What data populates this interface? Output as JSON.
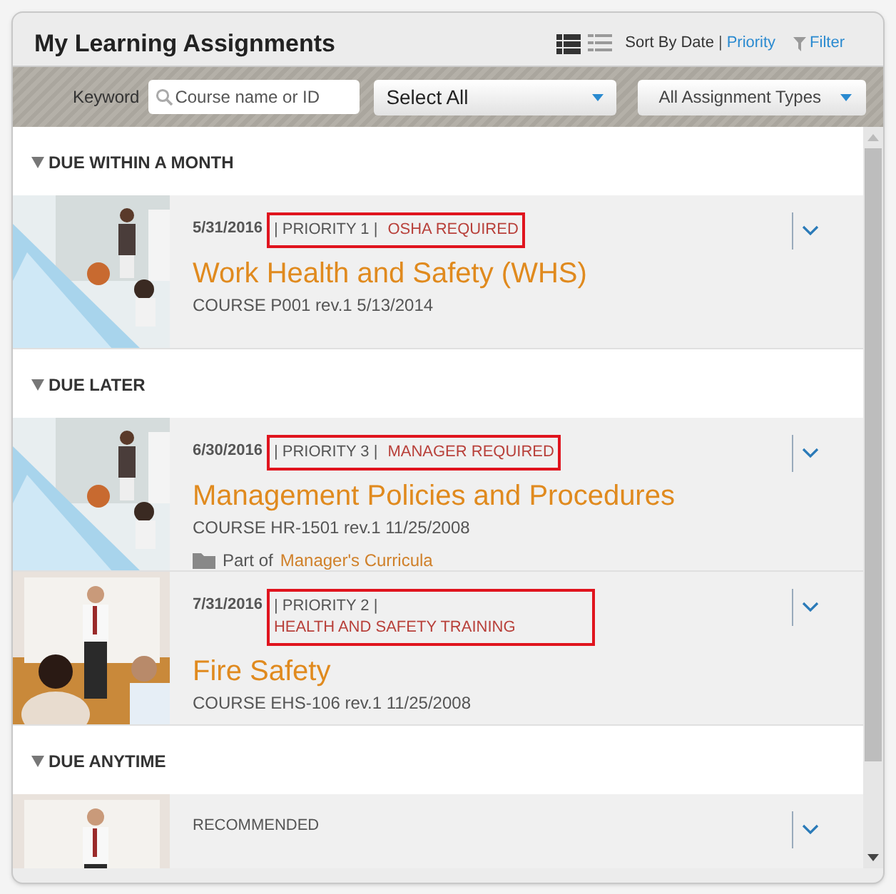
{
  "header": {
    "title": "My Learning Assignments",
    "view_modes": [
      {
        "kind": "detail",
        "selected": true
      },
      {
        "kind": "list",
        "selected": false
      }
    ],
    "sort_label": "Sort By",
    "sort_separator": "|",
    "sort_options": [
      {
        "label": "Date",
        "selected": true
      },
      {
        "label": "Priority",
        "selected": false
      }
    ],
    "filter_label": "Filter"
  },
  "filter_bar": {
    "keyword_label": "Keyword",
    "keyword_placeholder": "Course name or ID",
    "select": "Select All",
    "types": "All Assignment Types"
  },
  "sections": [
    {
      "title": "DUE WITHIN A MONTH",
      "expanded": true,
      "items": [
        {
          "date": "5/31/2016",
          "priority": "| PRIORITY 1 |",
          "requirement": "OSHA REQUIRED",
          "highlighted": true,
          "title": "Work Health and Safety (WHS)",
          "course": "COURSE P001 rev.1 5/13/2014"
        }
      ]
    },
    {
      "title": "DUE LATER",
      "expanded": true,
      "items": [
        {
          "date": "6/30/2016",
          "priority": "| PRIORITY 3 |",
          "requirement": "MANAGER REQUIRED",
          "highlighted": true,
          "title": "Management Policies and Procedures",
          "course": "COURSE HR-1501 rev.1 11/25/2008",
          "part_of_label": "Part of",
          "curricula": "Manager's Curricula"
        },
        {
          "date": "7/31/2016",
          "priority": "| PRIORITY 2 |",
          "requirement": "HEALTH AND SAFETY TRAINING",
          "highlighted": true,
          "title": "Fire Safety",
          "course": "COURSE EHS-106 rev.1 11/25/2008"
        }
      ]
    },
    {
      "title": "DUE ANYTIME",
      "expanded": true,
      "items": [
        {
          "recommended": "RECOMMENDED"
        }
      ]
    }
  ]
}
